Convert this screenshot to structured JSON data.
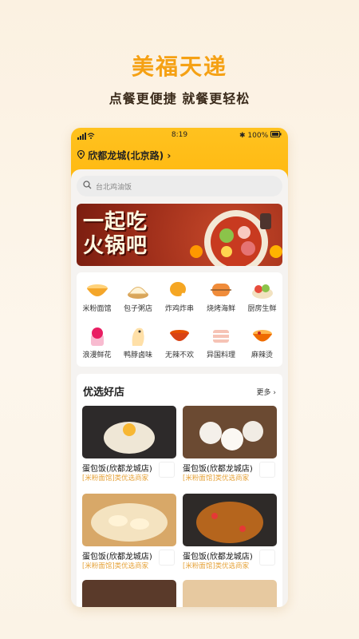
{
  "promo": {
    "headline": "美福天递",
    "subline": "点餐更便捷 就餐更轻松"
  },
  "statusbar": {
    "time": "8:19",
    "battery": "100%"
  },
  "location": {
    "label": "欣都龙城(北京路)"
  },
  "search": {
    "placeholder": "台北鸡油饭"
  },
  "banner": {
    "line1": "一起吃",
    "line2": "火锅吧"
  },
  "categories": [
    {
      "label": "米粉面馆",
      "icon": "noodle-bowl-icon"
    },
    {
      "label": "包子粥店",
      "icon": "bun-icon"
    },
    {
      "label": "炸鸡炸串",
      "icon": "fried-chicken-icon"
    },
    {
      "label": "烧烤海鲜",
      "icon": "bbq-icon"
    },
    {
      "label": "厨房生鲜",
      "icon": "fresh-produce-icon"
    },
    {
      "label": "浪漫鲜花",
      "icon": "flower-icon"
    },
    {
      "label": "鸭脖卤味",
      "icon": "duck-icon"
    },
    {
      "label": "无辣不欢",
      "icon": "spicy-icon"
    },
    {
      "label": "异国料理",
      "icon": "foreign-cuisine-icon"
    },
    {
      "label": "麻辣烫",
      "icon": "hotpot-icon"
    }
  ],
  "shops": {
    "title": "优选好店",
    "more": "更多",
    "items": [
      {
        "name": "蛋包饭(欣都龙城店)",
        "tag": "[米粉面馆]类优选商家"
      },
      {
        "name": "蛋包饭(欣都龙城店)",
        "tag": "[米粉面馆]类优选商家"
      },
      {
        "name": "蛋包饭(欣都龙城店)",
        "tag": "[米粉面馆]类优选商家"
      },
      {
        "name": "蛋包饭(欣都龙城店)",
        "tag": "[米粉面馆]类优选商家"
      }
    ]
  },
  "colors": {
    "brand": "#f5a114",
    "header": "#ffc21f",
    "tag": "#e6a33a"
  }
}
